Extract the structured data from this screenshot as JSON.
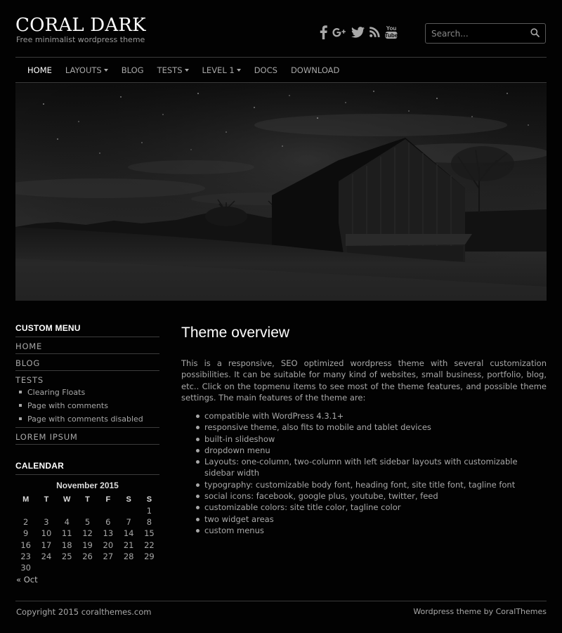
{
  "header": {
    "site_title": "CORAL DARK",
    "tagline": "Free minimalist wordpress theme",
    "social_icons": [
      "facebook-icon",
      "google-plus-icon",
      "twitter-icon",
      "rss-icon",
      "youtube-icon"
    ],
    "search_placeholder": "Search..."
  },
  "nav": {
    "items": [
      {
        "label": "HOME",
        "active": true,
        "dropdown": false
      },
      {
        "label": "LAYOUTS",
        "active": false,
        "dropdown": true
      },
      {
        "label": "BLOG",
        "active": false,
        "dropdown": false
      },
      {
        "label": "TESTS",
        "active": false,
        "dropdown": true
      },
      {
        "label": "LEVEL 1",
        "active": false,
        "dropdown": true
      },
      {
        "label": "DOCS",
        "active": false,
        "dropdown": false
      },
      {
        "label": "DOWNLOAD",
        "active": false,
        "dropdown": false
      }
    ]
  },
  "sidebar": {
    "custom_menu_title": "CUSTOM MENU",
    "menu": {
      "home": "HOME",
      "blog": "BLOG",
      "tests": "TESTS",
      "tests_sub": [
        "Clearing Floats",
        "Page with comments",
        "Page with comments disabled"
      ],
      "lorem": "LOREM IPSUM"
    },
    "calendar_title": "CALENDAR",
    "calendar": {
      "caption": "November 2015",
      "weekdays": [
        "M",
        "T",
        "W",
        "T",
        "F",
        "S",
        "S"
      ],
      "leading_blanks": 6,
      "days": 30,
      "prev_link": "« Oct"
    }
  },
  "content": {
    "heading": "Theme overview",
    "intro": "This is a responsive, SEO optimized wordpress theme with several customization possibilities. It can be suitable for many kind of websites, small business, portfolio, blog, etc.. Click on the topmenu items to see most of the theme features, and possible theme settings. The main features of the theme are:",
    "features": [
      "compatible with WordPress 4.3.1+",
      "responsive theme, also fits to mobile and tablet devices",
      "built-in slideshow",
      "dropdown menu",
      "Layouts: one-column, two-column with left sidebar layouts with customizable sidebar width",
      "typography: customizable body font, heading font, site title font, tagline font",
      "social icons: facebook, google plus, youtube, twitter, feed",
      "customizable colors: site title color, tagline color",
      "two widget areas",
      "custom menus"
    ]
  },
  "footer": {
    "copyright": "Copyright 2015 coralthemes.com",
    "credit": "Wordpress theme by CoralThemes"
  },
  "colors": {
    "background": "#020202",
    "text": "#a8a8a8",
    "heading": "#ffffff",
    "divider": "#3a3a3a"
  }
}
